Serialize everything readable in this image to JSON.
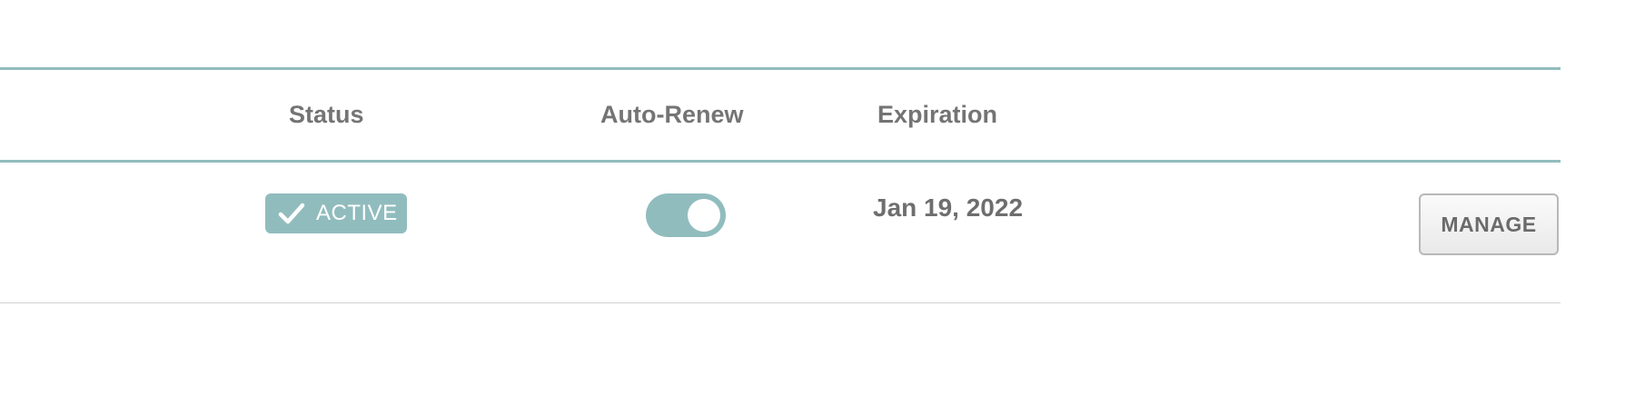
{
  "table": {
    "columns": {
      "status": "Status",
      "auto_renew": "Auto-Renew",
      "expiration": "Expiration"
    },
    "rows": [
      {
        "status": {
          "label": "ACTIVE",
          "icon": "checkmark-icon",
          "color": "#91bcbd"
        },
        "auto_renew": {
          "enabled": true,
          "color": "#91bcbd"
        },
        "expiration": "Jan 19, 2022",
        "action_label": "MANAGE"
      }
    ]
  },
  "colors": {
    "accent": "#92bcbd",
    "text": "#747474",
    "divider": "#d3d3d3"
  }
}
